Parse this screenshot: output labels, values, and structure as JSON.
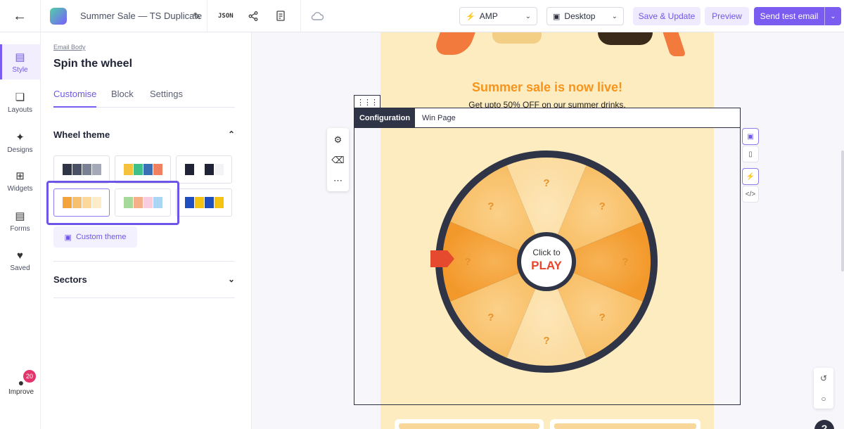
{
  "header": {
    "doc_title": "Summer Sale — TS Duplicate",
    "json_label": "JSON",
    "mode_select": "AMP",
    "device_select": "Desktop",
    "save_label": "Save & Update",
    "preview_label": "Preview",
    "send_label": "Send test email"
  },
  "rail": {
    "items": [
      {
        "label": "Style",
        "icon": "style-icon"
      },
      {
        "label": "Layouts",
        "icon": "layouts-icon"
      },
      {
        "label": "Designs",
        "icon": "designs-icon"
      },
      {
        "label": "Widgets",
        "icon": "widgets-icon"
      },
      {
        "label": "Forms",
        "icon": "forms-icon"
      },
      {
        "label": "Saved",
        "icon": "saved-icon"
      }
    ],
    "improve_label": "Improve",
    "improve_badge": "20"
  },
  "panel": {
    "breadcrumb": "Email Body",
    "title": "Spin the wheel",
    "tabs": [
      "Customise",
      "Block",
      "Settings"
    ],
    "active_tab": "Customise",
    "wheel_theme_heading": "Wheel theme",
    "custom_theme_label": "Custom theme",
    "sectors_heading": "Sectors",
    "themes": [
      {
        "colors": [
          "#2f3446",
          "#4a5164",
          "#7a8194",
          "#a3a9b8"
        ]
      },
      {
        "colors": [
          "#f6c23e",
          "#3fbf8a",
          "#3a6fb5",
          "#f08060"
        ]
      },
      {
        "colors": [
          "#1f2335",
          "#ffffff",
          "#1f2335",
          "#f3f3f6"
        ]
      },
      {
        "colors": [
          "#f5a33c",
          "#f7c070",
          "#fcd99a",
          "#fdecc8"
        ],
        "selected": true
      },
      {
        "colors": [
          "#a6d99a",
          "#f5b08a",
          "#f8cde0",
          "#a9d6f5"
        ]
      },
      {
        "colors": [
          "#1f4fbf",
          "#f5c211",
          "#1f4fbf",
          "#f5c211"
        ]
      }
    ]
  },
  "email": {
    "headline": "Summer sale is now live!",
    "subline": "Get upto 50% OFF on our summer drinks.",
    "config_tab": "Configuration",
    "win_page_tab": "Win Page",
    "wheel_click_label": "Click to",
    "wheel_play_label": "PLAY",
    "sector_marks": [
      "?",
      "?",
      "?",
      "?",
      "?",
      "?",
      "?",
      "?"
    ]
  },
  "colors": {
    "accent": "#7a5cf0",
    "headline": "#f7941e",
    "email_bg": "#fdecbf"
  }
}
